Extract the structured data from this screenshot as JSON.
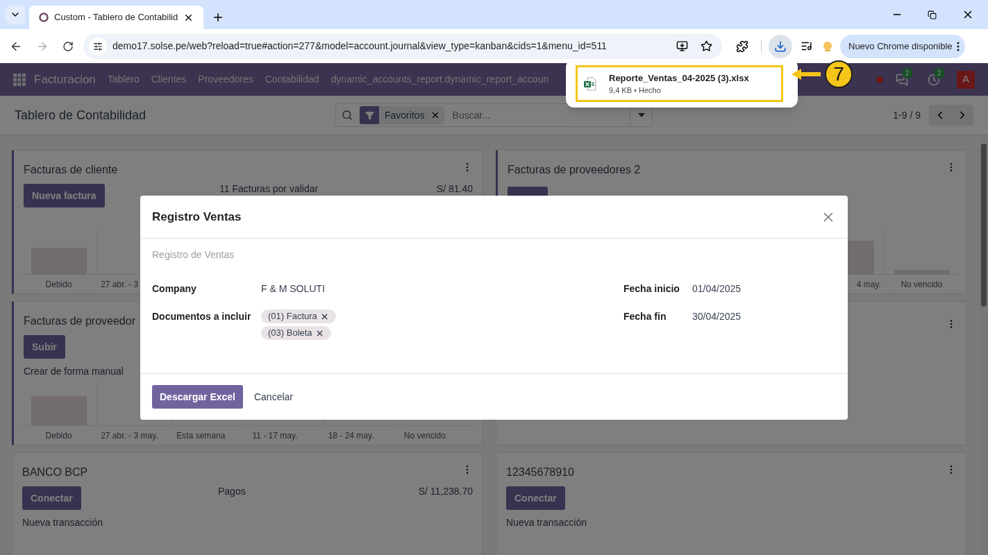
{
  "browser": {
    "tab_title": "Custom - Tablero de Contabilid",
    "url": "demo17.solse.pe/web?reload=true#action=277&model=account.journal&view_type=kanban&cids=1&menu_id=511",
    "forward_disabled": true,
    "downloads_open": true,
    "update_button": "Nuevo Chrome disponible"
  },
  "download": {
    "filename": "Reporte_Ventas_04-2025 (3).xlsx",
    "status": "9,4 KB • Hecho",
    "annotation": "7"
  },
  "navbar": {
    "app": "Facturacion",
    "menu": [
      "Tablero",
      "Clientes",
      "Proveedores",
      "Contabilidad",
      "dynamic_accounts_report.dynamic_report_accoun"
    ],
    "messages_badge": "2",
    "activities_badge": "2",
    "avatar": "A"
  },
  "control_panel": {
    "title": "Tablero de Contabilidad",
    "facet": "Favoritos",
    "search_placeholder": "Buscar...",
    "pager": "1-9 / 9"
  },
  "cards": [
    {
      "kind": "journal",
      "accent": true,
      "title": "Facturas de cliente",
      "button": "Nueva factura",
      "info": "11 Facturas por validar",
      "amount": "S/ 81.40",
      "axis": [
        "Debido",
        "27 abr. - 3"
      ]
    },
    {
      "kind": "covered",
      "accent": true,
      "title": "Facturas de proveedores 2",
      "axis": [
        "4 may.",
        "No vencido"
      ]
    },
    {
      "kind": "purchase",
      "accent": true,
      "title": "Facturas de proveedor",
      "button": "Subir",
      "note": "Crear de forma manual",
      "axis": [
        "Debido",
        "27 abr. - 3 may.",
        "Esta semana",
        "11 - 17 may.",
        "18 - 24 may.",
        "No vencido"
      ]
    },
    {
      "kind": "hidden",
      "accent": false
    },
    {
      "kind": "bank",
      "accent": false,
      "title": "BANCO BCP",
      "button": "Conectar",
      "info": "Pagos",
      "amount": "S/ 11,238.70",
      "note": "Nueva transacción"
    },
    {
      "kind": "bank",
      "accent": false,
      "title": "12345678910",
      "button": "Conectar",
      "note": "Nueva transacción"
    }
  ],
  "dialog": {
    "title": "Registro Ventas",
    "subtitle": "Registro de Ventas",
    "left_fields": [
      {
        "kind": "text",
        "label": "Company",
        "value": "F & M SOLUTI"
      },
      {
        "kind": "tags",
        "label": "Documentos a incluir",
        "tags": [
          "(01) Factura",
          "(03) Boleta"
        ]
      }
    ],
    "right_fields": [
      {
        "kind": "text",
        "label": "Fecha inicio",
        "value": "01/04/2025"
      },
      {
        "kind": "text",
        "label": "Fecha fin",
        "value": "30/04/2025"
      }
    ],
    "primary_button": "Descargar Excel",
    "secondary_button": "Cancelar"
  }
}
